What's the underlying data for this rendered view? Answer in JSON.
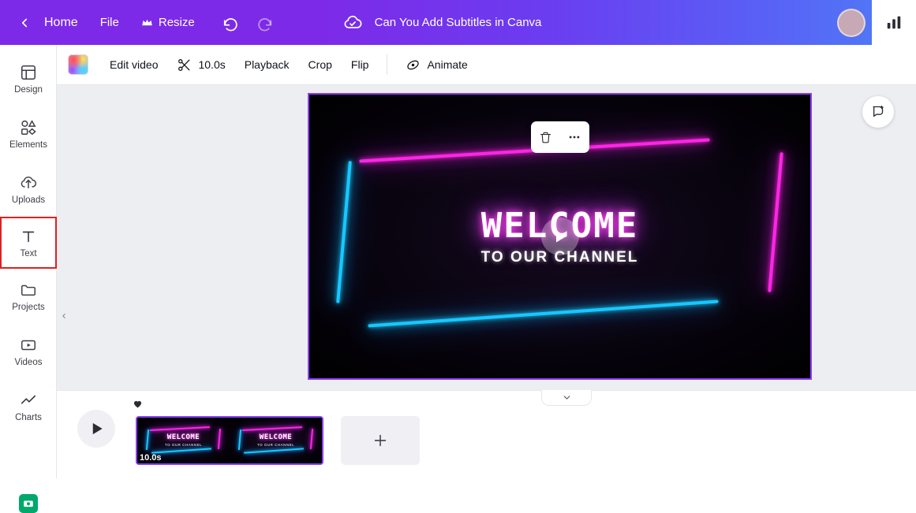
{
  "topbar": {
    "back_icon": "chevron-left-icon",
    "home_label": "Home",
    "file_label": "File",
    "resize_label": "Resize",
    "resize_icon": "crown-icon",
    "undo_icon": "undo-icon",
    "redo_icon": "redo-icon",
    "cloud_icon": "cloud-saved-icon",
    "design_title": "Can You Add Subtitles in Canva",
    "avatar_name": "user-avatar",
    "stats_icon": "bar-chart-icon"
  },
  "sidebar": {
    "items": [
      {
        "label": "Design",
        "icon": "design-grid-icon",
        "selected": false
      },
      {
        "label": "Elements",
        "icon": "elements-shapes-icon",
        "selected": false
      },
      {
        "label": "Uploads",
        "icon": "upload-cloud-icon",
        "selected": false
      },
      {
        "label": "Text",
        "icon": "text-T-icon",
        "selected": true
      },
      {
        "label": "Projects",
        "icon": "folder-icon",
        "selected": false
      },
      {
        "label": "Videos",
        "icon": "video-play-icon",
        "selected": false
      },
      {
        "label": "Charts",
        "icon": "line-chart-icon",
        "selected": false
      }
    ]
  },
  "toolbar": {
    "color_swatch": "gradient-color-swatch",
    "edit_video_label": "Edit video",
    "scissors_icon": "scissors-icon",
    "duration_label": "10.0s",
    "playback_label": "Playback",
    "crop_label": "Crop",
    "flip_label": "Flip",
    "animate_label": "Animate",
    "animate_icon": "animate-icon"
  },
  "canvas": {
    "welcome_text": "WELCOME",
    "subtitle_text": "TO OUR CHANNEL",
    "play_icon": "play-icon",
    "context_menu": {
      "delete_icon": "trash-icon",
      "more_icon": "more-dots-icon"
    },
    "ai_button_icon": "magic-sparkle-icon",
    "left_arrow_icon": "chevron-left-small-icon"
  },
  "timeline": {
    "collapse_icon": "chevron-down-icon",
    "play_icon": "play-icon",
    "heart_icon": "heart-icon",
    "clip": {
      "duration_label": "10.0s",
      "thumb_text": "WELCOME",
      "thumb_subtext": "TO OUR CHANNEL"
    },
    "add_page_icon": "plus-icon"
  }
}
